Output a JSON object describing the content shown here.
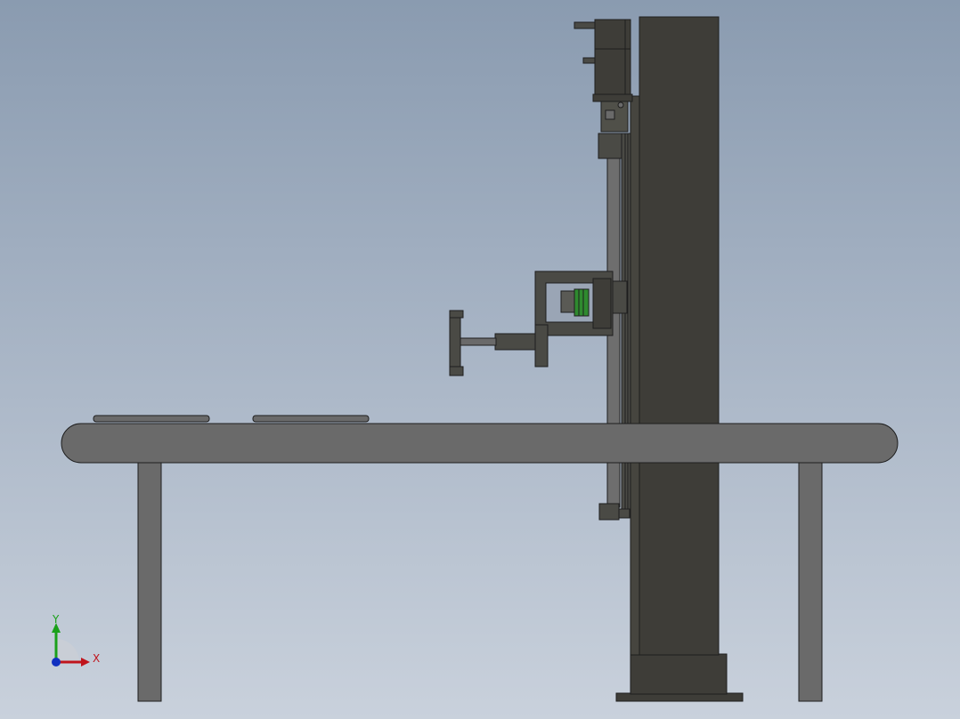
{
  "triad": {
    "x_label": "X",
    "y_label": "Y",
    "x_color": "#c0141c",
    "y_color": "#1aa01a",
    "z_color": "#1030c0"
  },
  "colors": {
    "background_top": "#8a9bb0",
    "background_bottom": "#c9d1dc",
    "body": "#6a6a6a",
    "dark_steel": "#3e3d38",
    "outline": "#1e1e1e",
    "accent_green": "#2f8a2f"
  }
}
